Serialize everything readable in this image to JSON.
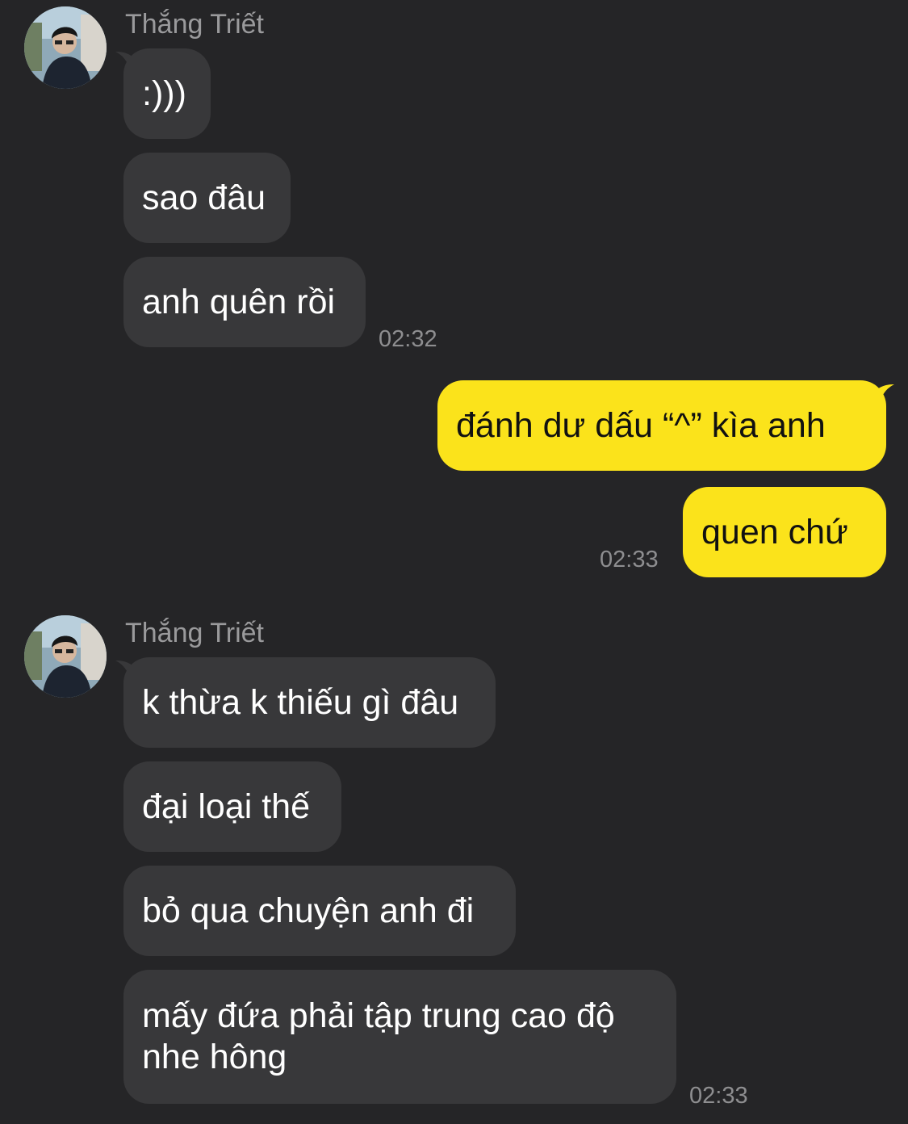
{
  "groups": [
    {
      "sender": "Thắng Triết",
      "avatar": "user-avatar-photo",
      "messages": [
        ":)))",
        "sao đâu",
        "anh quên rồi"
      ],
      "time": "02:32"
    },
    {
      "sender": "me",
      "messages": [
        "đánh dư dấu “^” kìa anh",
        "quen chứ"
      ],
      "time": "02:33"
    },
    {
      "sender": "Thắng Triết",
      "avatar": "user-avatar-photo",
      "messages": [
        "k thừa k thiếu gì đâu",
        "đại loại thế",
        "bỏ qua chuyện anh đi",
        "mấy đứa phải tập trung cao độ nhe hông"
      ],
      "time": "02:33"
    }
  ],
  "colors": {
    "background": "#252527",
    "incoming_bubble": "#38383a",
    "outgoing_bubble": "#fbe31b",
    "secondary_text": "#9a9a9c"
  }
}
